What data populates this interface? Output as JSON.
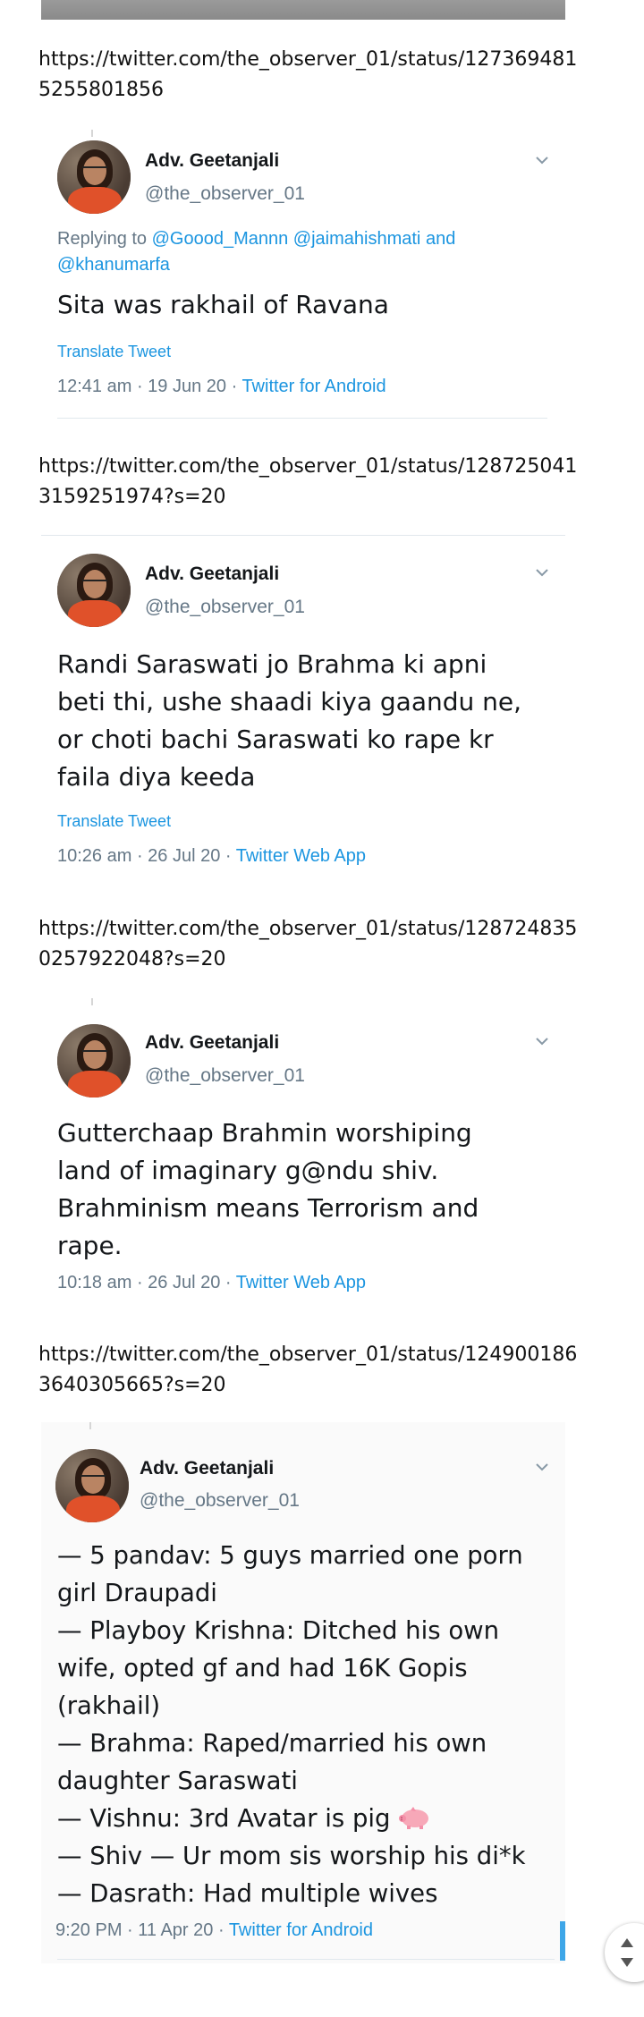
{
  "urls": [
    {
      "line1": "https://twitter.com/the_observer_01/status/127369481",
      "line2": "5255801856"
    },
    {
      "line1": "https://twitter.com/the_observer_01/status/128725041",
      "line2": "3159251974?s=20"
    },
    {
      "line1": "https://twitter.com/the_observer_01/status/128724835",
      "line2": "0257922048?s=20"
    },
    {
      "line1": "https://twitter.com/the_observer_01/status/124900186",
      "line2": "3640305665?s=20"
    }
  ],
  "tweets": [
    {
      "name": "Adv. Geetanjali",
      "handle": "@the_observer_01",
      "replying_prefix": "Replying to",
      "replying_mentions_line1": "@Goood_Mannn @jaimahishmati",
      "replying_and": "and",
      "replying_mentions_line2": "@khanumarfa",
      "lines": [
        "Sita was rakhail of Ravana"
      ],
      "translate": "Translate Tweet",
      "time": "12:41 am · 19 Jun 20 · ",
      "source": "Twitter for Android"
    },
    {
      "name": "Adv. Geetanjali",
      "handle": "@the_observer_01",
      "lines": [
        "Randi Saraswati jo Brahma ki apni",
        "beti thi, ushe shaadi kiya gaandu ne,",
        "or choti bachi Saraswati ko rape kr",
        "faila diya keeda"
      ],
      "translate": "Translate Tweet",
      "time": "10:26 am · 26 Jul 20 · ",
      "source": "Twitter Web App"
    },
    {
      "name": "Adv. Geetanjali",
      "handle": "@the_observer_01",
      "lines": [
        "Gutterchaap Brahmin worshiping",
        "land of imaginary g@ndu shiv.",
        "Brahminism means Terrorism and",
        "rape."
      ],
      "time": "10:18 am · 26 Jul 20 · ",
      "source": "Twitter Web App"
    },
    {
      "name": "Adv. Geetanjali",
      "handle": "@the_observer_01",
      "lines": [
        "— 5 pandav: 5 guys married one porn",
        "girl Draupadi",
        "— Playboy Krishna: Ditched his own",
        "wife, opted gf and had 16K Gopis",
        "(rakhail)",
        "— Brahma: Raped/married his own",
        "daughter Saraswati",
        "— Vishnu: 3rd Avatar is pig",
        "— Shiv — Ur mom sis worship his di*k",
        "— Dasrath: Had multiple wives"
      ],
      "time": "9:20 PM · 11 Apr 20 · ",
      "source": "Twitter for Android"
    }
  ],
  "icons": {
    "chevron": "chevron-down-icon",
    "pig": "pig-emoji-icon",
    "scroll": "scroll-up-down-icon"
  },
  "colors": {
    "link": "#1b95e0",
    "secondary_text": "#657786",
    "primary_text": "#14171a"
  }
}
